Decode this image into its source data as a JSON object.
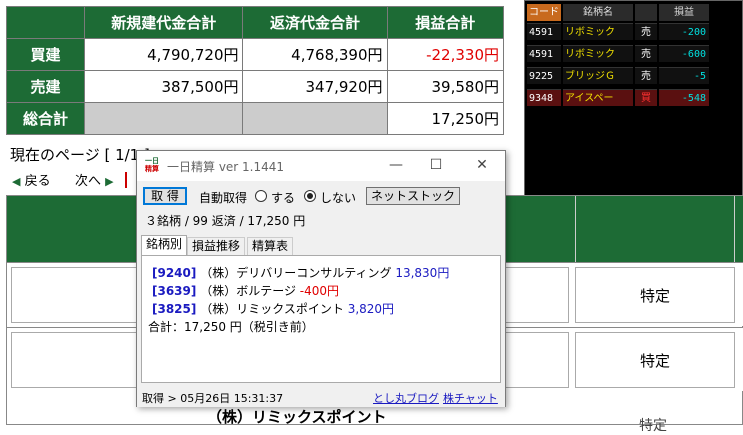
{
  "summary": {
    "headers": [
      "新規建代金合計",
      "返済代金合計",
      "損益合計"
    ],
    "rows": [
      {
        "label": "買建",
        "new": "4,790,720円",
        "repay": "4,768,390円",
        "pl": "-22,330円"
      },
      {
        "label": "売建",
        "new": "387,500円",
        "repay": "347,920円",
        "pl": "39,580円"
      },
      {
        "label": "総合計",
        "new": "",
        "repay": "",
        "pl": "17,250円"
      }
    ]
  },
  "ticker": {
    "headers": [
      "コード",
      "銘柄名",
      "",
      "損益"
    ],
    "rows": [
      {
        "code": "4591",
        "name": "リボミック",
        "side": "売",
        "pl": "-200"
      },
      {
        "code": "4591",
        "name": "リボミック",
        "side": "売",
        "pl": "-600"
      },
      {
        "code": "9225",
        "name": "ブリッジＧ",
        "side": "売",
        "pl": "-5"
      },
      {
        "code": "9348",
        "name": "アイスペー",
        "side": "買",
        "pl": "-548"
      }
    ]
  },
  "nav": {
    "page_info": "現在のページ [ 1/1 ]",
    "back": "戻る",
    "next": "次へ"
  },
  "lower": {
    "tokutei": "特定",
    "bottom_name": "（株）リミックスポイント"
  },
  "window": {
    "title": "一日精算 ver 1.1441",
    "icon_text_top": "一日",
    "icon_text_bottom": "精算",
    "minimize": "—",
    "maximize": "☐",
    "close": "✕",
    "fetch_button": "取 得",
    "auto_label": "自動取得",
    "radio_yes": "する",
    "radio_no": "しない",
    "netstock_button": "ネットストック",
    "summary_line": "３銘柄 / 99 返済 / 17,250 円",
    "tabs": [
      "銘柄別",
      "損益推移",
      "精算表"
    ],
    "items": [
      {
        "code": "[9240]",
        "name": "（株）デリバリーコンサルティング",
        "amount": "13,830円",
        "neg": false
      },
      {
        "code": "[3639]",
        "name": "（株）ボルテージ",
        "amount": "-400円",
        "neg": true
      },
      {
        "code": "[3825]",
        "name": "（株）リミックスポイント",
        "amount": "3,820円",
        "neg": false
      }
    ],
    "total": "合計：17,250 円（税引き前）",
    "status": "取得 > 05月26日 15:31:37",
    "link1": "とし丸ブログ",
    "link2": "株チャット"
  }
}
